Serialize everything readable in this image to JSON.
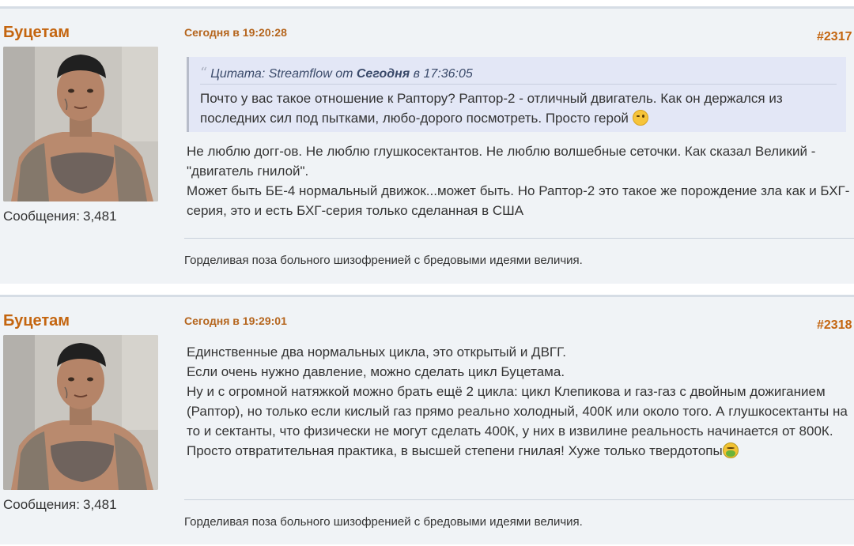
{
  "posts": [
    {
      "author": "Буцетам",
      "messages_label": "Сообщения:",
      "messages_count": "3,481",
      "date": "Сегодня в 19:20:28",
      "post_number": "#2317",
      "quote": {
        "prefix": "Цитата: Streamflow от",
        "when_bold": "Сегодня",
        "when_rest": "в 17:36:05",
        "text_line1": "Почто у вас такое отношение к Раптору? Раптор-2 - отличный двигатель. Как он держался из",
        "text_line2": "последних сил под пытками, любо-дорого посмотреть. Просто герой",
        "emoji": "wink-emoji"
      },
      "body": [
        "Не люблю догг-ов. Не люблю глушкосектантов. Не люблю волшебные сеточки. Как сказал Великий - \"двигатель гнилой\".",
        "Может быть БЕ-4 нормальный движок...может быть. Но Раптор-2 это такое же порождение зла как и БХГ-серия, это и есть БХГ-серия только сделанная в США"
      ],
      "signature": "Горделивая поза больного шизофренией с бредовыми идеями величия."
    },
    {
      "author": "Буцетам",
      "messages_label": "Сообщения:",
      "messages_count": "3,481",
      "date": "Сегодня в 19:29:01",
      "post_number": "#2318",
      "body": [
        "Единственные два нормальных цикла, это открытый и ДВГГ.",
        "Если очень нужно давление, можно сделать цикл Буцетама.",
        "Ну и с огромной натяжкой можно брать ещё 2 цикла:  цикл Клепикова и газ-газ с двойным дожиганием (Раптор), но только если кислый газ прямо реально холодный, 400К или около того. А глушкосектанты на то и сектанты, что физически не могут сделать 400К, у них в извилине реальность начинается от 800К. Просто отвратительная практика, в высшей степени гнилая! Хуже только твердотопы"
      ],
      "body_emoji": "nauseated-emoji",
      "signature": "Горделивая поза больного шизофренией с бредовыми идеями величия."
    }
  ],
  "colors": {
    "author": "#c4650f",
    "date": "#b5651d",
    "post_bg": "#f0f3f6",
    "quote_bg": "#e3e7f6"
  }
}
